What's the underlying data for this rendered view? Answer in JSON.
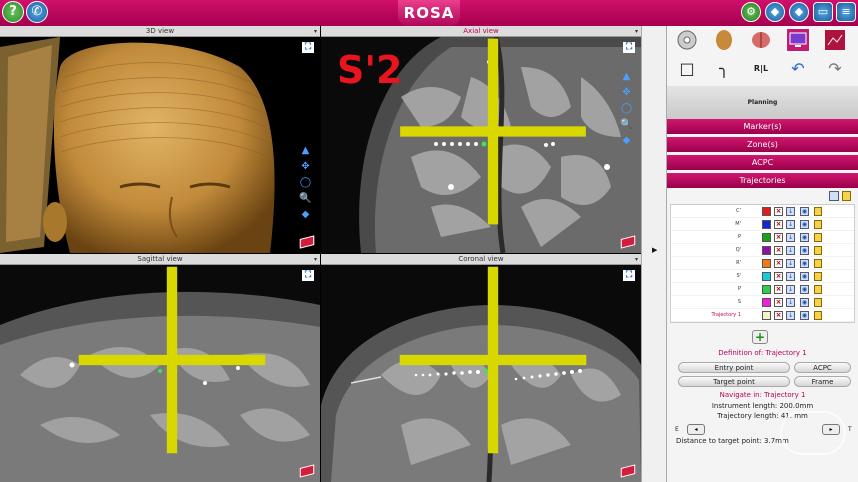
{
  "app": {
    "name": "ROSA"
  },
  "topbar": {
    "help_icon": "question-circle",
    "phone_icon": "phone",
    "help_glyph": "?",
    "phone_glyph": "✆",
    "right_icons": [
      "settings-gear",
      "diamond",
      "diamond",
      "monitor",
      "document"
    ]
  },
  "viewports": {
    "view3d": {
      "title": "3D view"
    },
    "axial": {
      "title": "Axial view",
      "overlay_text": "S'2"
    },
    "sagittal": {
      "title": "Sagittal view"
    },
    "coronal": {
      "title": "Coronal view"
    },
    "dropdown_glyph": "▾",
    "maximize_glyph": "⛶",
    "tools": [
      "▲",
      "✥",
      "◯",
      "🔍",
      "◆"
    ]
  },
  "panel": {
    "tool_icons_row1": [
      "disc-icon",
      "head-icon",
      "brain-icon",
      "monitor-icon",
      "image-icon"
    ],
    "tool_icons_row2": [
      "square-icon",
      "curve-icon",
      "rl-icon",
      "undo-icon",
      "redo-icon"
    ],
    "tool_glyphs_row2": [
      "□",
      "╮",
      "R|L",
      "↶",
      "↷"
    ],
    "mode_title": "Planning",
    "sections": [
      "Marker(s)",
      "Zone(s)",
      "ACPC",
      "Trajectories"
    ],
    "trajectories": [
      {
        "name": "C'",
        "color": "#e01e1e"
      },
      {
        "name": "M'",
        "color": "#1428d2"
      },
      {
        "name": "P",
        "color": "#17a217"
      },
      {
        "name": "Q'",
        "color": "#8b10a8"
      },
      {
        "name": "R'",
        "color": "#f07a14"
      },
      {
        "name": "S'",
        "color": "#16c8e0"
      },
      {
        "name": "P",
        "color": "#2ad04c"
      },
      {
        "name": "S",
        "color": "#f01ee0"
      },
      {
        "name": "Trajectory 1",
        "color": "#f5f5c8",
        "selected": true
      }
    ],
    "add_label": "+",
    "definition_title": "Definition of: Trajectory 1",
    "entry_point": "Entry point",
    "acpc": "ACPC",
    "target_point": "Target point",
    "frame": "Frame",
    "navigate_title": "Navigate in: Trajectory 1",
    "instrument_length": "Instrument length: 200.0mm",
    "trajectory_length": "Trajectory length: 41.  mm",
    "nav_e": "E",
    "nav_t": "T",
    "prev_glyph": "◂",
    "next_glyph": "▸",
    "distance": "Distance to target point: 3.7mm"
  }
}
